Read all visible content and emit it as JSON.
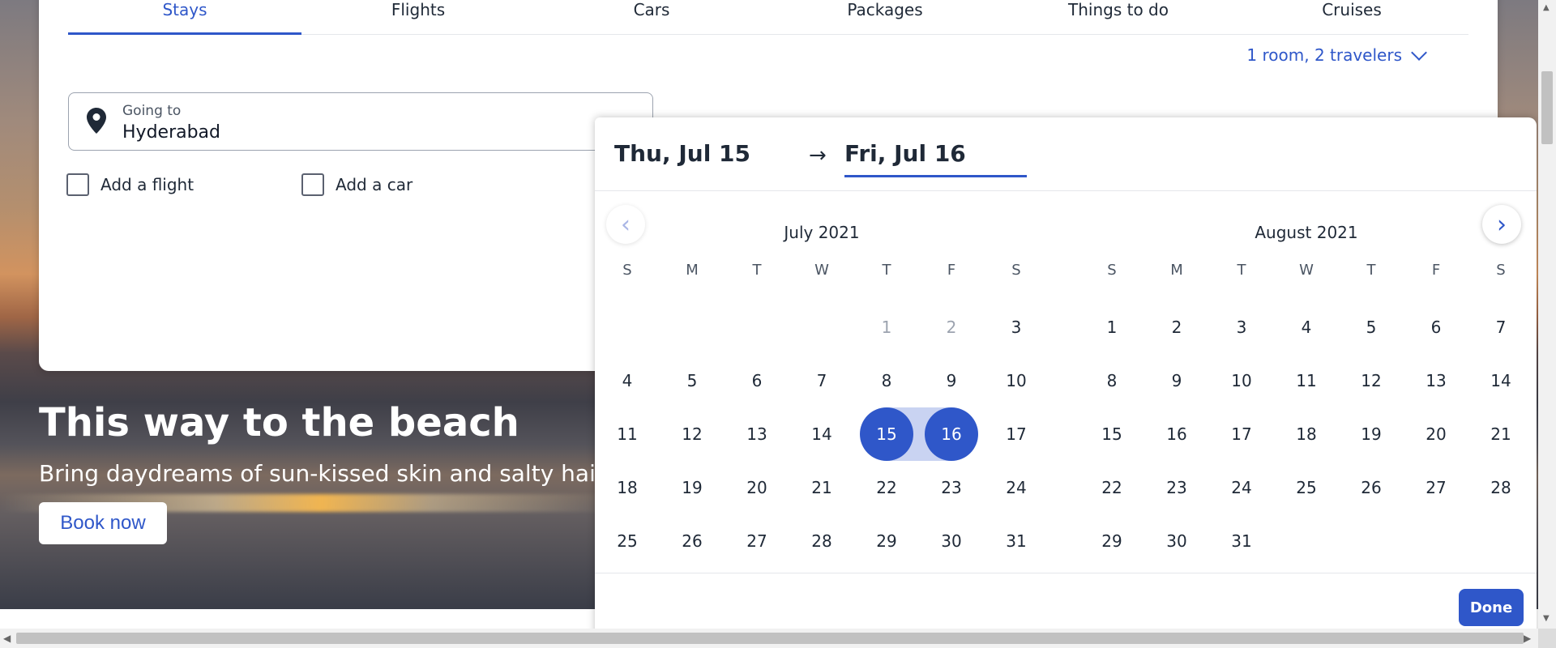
{
  "tabs": [
    {
      "label": "Stays",
      "active": true
    },
    {
      "label": "Flights"
    },
    {
      "label": "Cars"
    },
    {
      "label": "Packages"
    },
    {
      "label": "Things to do"
    },
    {
      "label": "Cruises"
    }
  ],
  "travelers": "1 room, 2 travelers",
  "going": {
    "label": "Going to",
    "value": "Hyderabad"
  },
  "checkboxes": [
    {
      "label": "Add a flight"
    },
    {
      "label": "Add a car"
    }
  ],
  "hero": {
    "title": "This way to the beach",
    "subtitle": "Bring daydreams of sun-kissed skin and salty hair to",
    "button": "Book now"
  },
  "datepicker": {
    "start": "Thu, Jul 15",
    "end": "Fri, Jul 16",
    "arrow": "→",
    "prev": "‹",
    "next": "›",
    "done": "Done",
    "dow": [
      "S",
      "M",
      "T",
      "W",
      "T",
      "F",
      "S"
    ],
    "months": [
      {
        "title": "July 2021",
        "offset": 4,
        "start": 1,
        "days": 31,
        "muted_until": 2,
        "selected": [
          15,
          16
        ]
      },
      {
        "title": "August 2021",
        "offset": 0,
        "start": 1,
        "days": 31,
        "muted_until": 0,
        "selected": []
      }
    ]
  },
  "colors": {
    "accent": "#2f57c9",
    "range": "#c9d3f2"
  }
}
